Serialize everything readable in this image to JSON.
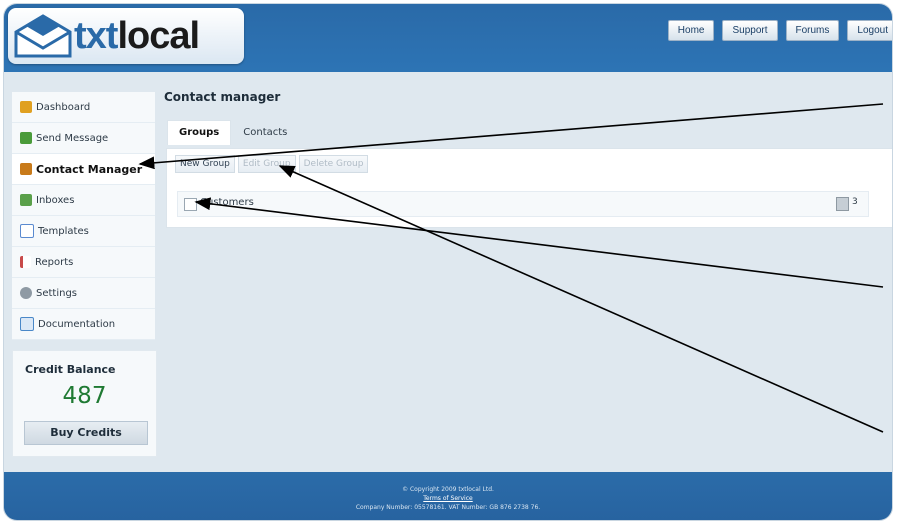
{
  "logo": {
    "text_txt": "txt",
    "text_local": "local"
  },
  "nav": [
    {
      "label": "Home"
    },
    {
      "label": "Support"
    },
    {
      "label": "Forums"
    },
    {
      "label": "Logout"
    }
  ],
  "sidebar": {
    "items": [
      {
        "label": "Dashboard",
        "icon": "house-icon",
        "color": "#e0a020"
      },
      {
        "label": "Send Message",
        "icon": "message-icon",
        "color": "#4a9b3a"
      },
      {
        "label": "Contact Manager",
        "icon": "contacts-icon",
        "color": "#c87a1a"
      },
      {
        "label": "Inboxes",
        "icon": "inbox-icon",
        "color": "#5aa04a"
      },
      {
        "label": "Templates",
        "icon": "template-icon",
        "color": "#5a8ad0"
      },
      {
        "label": "Reports",
        "icon": "report-icon",
        "color": "#c84a4a"
      },
      {
        "label": "Settings",
        "icon": "wrench-icon",
        "color": "#8f9aa4"
      },
      {
        "label": "Documentation",
        "icon": "document-icon",
        "color": "#4a88c8"
      }
    ]
  },
  "credit": {
    "title": "Credit Balance",
    "value": "487",
    "buy_label": "Buy Credits"
  },
  "content": {
    "title": "Contact manager",
    "tabs": [
      {
        "label": "Groups"
      },
      {
        "label": "Contacts"
      }
    ],
    "toolbar": {
      "new_group": "New Group",
      "edit_group": "Edit Group",
      "delete_group": "Delete Group"
    },
    "groups": [
      {
        "name": "Customers",
        "count": "3"
      }
    ]
  },
  "footer": {
    "copyright": "© Copyright 2009 txtlocal Ltd.",
    "terms": "Terms of Service",
    "company": "Company Number: 05578161. VAT Number: GB 876 2738 76."
  },
  "colors": {
    "header_blue": "#2d74b5",
    "credit_green": "#1f7a33",
    "arrow": "#000000"
  }
}
